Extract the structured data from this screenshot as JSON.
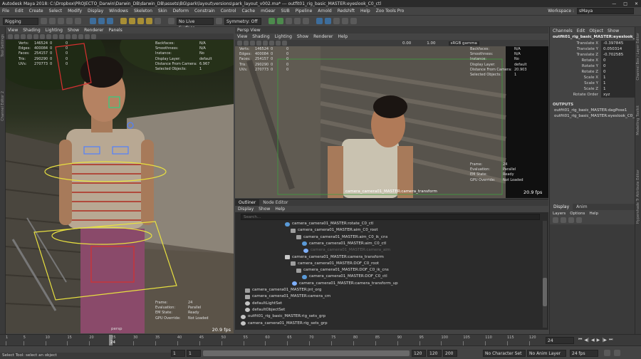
{
  "title_bar": {
    "title": "Autodesk Maya 2018: C:\\Dropbox\\PROJECTO_Darwin\\Darwin_DB\\darwin_DB\\assets\\BG\\park\\layout\\versions\\park_layout_v002.ma*  ---  outfit01_rig_basic_MASTER:eyeslook_C0_ctl",
    "minimize": "—",
    "maximize": "□",
    "close": "✕"
  },
  "menubar": {
    "items": [
      "File",
      "Edit",
      "Create",
      "Select",
      "Modify",
      "Display",
      "Windows",
      "Skeleton",
      "Skin",
      "Deform",
      "Constrain",
      "Control",
      "Cache",
      "mGear",
      "SUB",
      "Pipeline",
      "Arnold",
      "Redshift",
      "Help",
      "Zoo Tools Pro"
    ],
    "workspace_label": "Workspace :",
    "workspace_value": "sMaya"
  },
  "statusline": {
    "menuset": "Rigging",
    "live_surface": "No Live Surface",
    "symmetry": "Symmetry: Off"
  },
  "left_tools_label": "Tool Settings",
  "left_tools_label2": "Channel Editor 2",
  "left_viewport": {
    "menu": [
      "View",
      "Shading",
      "Lighting",
      "Show",
      "Renderer",
      "Panels"
    ],
    "hud_left": [
      {
        "label": "Verts:",
        "a": "146524",
        "b": "0",
        "c": "0"
      },
      {
        "label": "Edges:",
        "a": "400084",
        "b": "0",
        "c": "0"
      },
      {
        "label": "Faces:",
        "a": "254157",
        "b": "0",
        "c": "0"
      },
      {
        "label": "Tris:",
        "a": "290290",
        "b": "0",
        "c": "0"
      },
      {
        "label": "UVs:",
        "a": "270773",
        "b": "0",
        "c": "0"
      }
    ],
    "hud_right": [
      {
        "label": "Backfaces:",
        "value": "N/A"
      },
      {
        "label": "Smoothness:",
        "value": "N/A"
      },
      {
        "label": "Instance:",
        "value": "No"
      },
      {
        "label": "Display Layer:",
        "value": "default"
      },
      {
        "label": "Distance From Camera:",
        "value": "6.967"
      },
      {
        "label": "Selected Objects:",
        "value": "1"
      }
    ],
    "hud_bottom": [
      {
        "label": "Frame:",
        "value": "24"
      },
      {
        "label": "Evaluation:",
        "value": "Parallel"
      },
      {
        "label": "EM State:",
        "value": "Ready"
      },
      {
        "label": "GPU Override:",
        "value": "Not Loaded"
      }
    ],
    "camera_name": "persp",
    "fps": "20.9 fps"
  },
  "persp_view": {
    "title": "Persp View",
    "menu": [
      "View",
      "Shading",
      "Lighting",
      "Show",
      "Renderer",
      "Help"
    ],
    "exposure": "0.00",
    "gamma": "1.00",
    "colorspace": "sRGB gamma",
    "hud_left": [
      {
        "label": "Verts:",
        "a": "146524",
        "b": "0",
        "c": "0"
      },
      {
        "label": "Edges:",
        "a": "400084",
        "b": "0",
        "c": "0"
      },
      {
        "label": "Faces:",
        "a": "254157",
        "b": "0",
        "c": "0"
      },
      {
        "label": "Tris:",
        "a": "290290",
        "b": "0",
        "c": "0"
      },
      {
        "label": "UVs:",
        "a": "270773",
        "b": "0",
        "c": "0"
      }
    ],
    "hud_right": [
      {
        "label": "Backfaces:",
        "value": "N/A"
      },
      {
        "label": "Smoothness:",
        "value": "N/A"
      },
      {
        "label": "Instance:",
        "value": "No"
      },
      {
        "label": "Display Layer:",
        "value": "default"
      },
      {
        "label": "Distance From Camera:",
        "value": "20.903"
      },
      {
        "label": "Selected Objects:",
        "value": "1"
      }
    ],
    "hud_bottom": [
      {
        "label": "Frame:",
        "value": "24"
      },
      {
        "label": "Evaluation:",
        "value": "Parallel"
      },
      {
        "label": "EM State:",
        "value": "Ready"
      },
      {
        "label": "GPU Override:",
        "value": "Not Loaded"
      }
    ],
    "camera_name": "camera_camera01_MASTER:camera_transform",
    "fps": "20.9 fps"
  },
  "outliner": {
    "tabs": [
      "Outliner",
      "Node Editor"
    ],
    "menu": [
      "Display",
      "Show",
      "Help"
    ],
    "search_placeholder": "Search...",
    "items": [
      {
        "label": "camera_camera01_MASTER:rotate_C0_ctl",
        "icon": "crv",
        "dim": false
      },
      {
        "label": "camera_camera01_MASTER:aim_C0_root",
        "icon": "tr",
        "dim": false
      },
      {
        "label": "camera_camera01_MASTER:aim_C0_ik_cns",
        "icon": "tr",
        "dim": false
      },
      {
        "label": "camera_camera01_MASTER:aim_C0_ctl",
        "icon": "crv",
        "dim": false
      },
      {
        "label": "camera_camera01_MASTER:camera_aim",
        "icon": "jnt",
        "dim": true
      },
      {
        "label": "camera_camera01_MASTER:camera_transform",
        "icon": "cam",
        "dim": false
      },
      {
        "label": "camera_camera01_MASTER:DOF_C0_root",
        "icon": "tr",
        "dim": false
      },
      {
        "label": "camera_camera01_MASTER:DOF_C0_ik_cns",
        "icon": "tr",
        "dim": false
      },
      {
        "label": "camera_camera01_MASTER:DOF_C0_ctl",
        "icon": "crv",
        "dim": false
      },
      {
        "label": "camera_camera01_MASTER:camera_transform_up",
        "icon": "jnt",
        "dim": false
      },
      {
        "label": "camera_camera01_MASTER:jnt_org",
        "icon": "tr",
        "dim": false
      },
      {
        "label": "camera_camera01_MASTER:camera_cm",
        "icon": "grp",
        "dim": false
      },
      {
        "label": "defaultLightSet",
        "icon": "set",
        "dim": false
      },
      {
        "label": "defaultObjectSet",
        "icon": "set",
        "dim": false
      },
      {
        "label": "outfit01_rig_basic_MASTER:rig_sets_grp",
        "icon": "set",
        "dim": false
      },
      {
        "label": "camera_camera01_MASTER:rig_sets_grp",
        "icon": "set",
        "dim": false
      }
    ]
  },
  "channel_box": {
    "menu": [
      "Channels",
      "Edit",
      "Object",
      "Show"
    ],
    "object_name": "outfit01_rig_basic_MASTER:eyeslook_C0_ctl",
    "channels": [
      {
        "name": "Translate X",
        "value": "-0.397845"
      },
      {
        "name": "Translate Y",
        "value": "0.050314"
      },
      {
        "name": "Translate Z",
        "value": "-0.702585"
      },
      {
        "name": "Rotate X",
        "value": "0"
      },
      {
        "name": "Rotate Y",
        "value": "0"
      },
      {
        "name": "Rotate Z",
        "value": "0"
      },
      {
        "name": "Scale X",
        "value": "1"
      },
      {
        "name": "Scale Y",
        "value": "1"
      },
      {
        "name": "Scale Z",
        "value": "1"
      },
      {
        "name": "Rotate Order",
        "value": "xyz"
      }
    ],
    "outputs_label": "OUTPUTS",
    "outputs": [
      "outfit01_rig_basic_MASTER:dagPose1",
      "outfit01_rig_basic_MASTER:eyeslook_C0_ctl..."
    ],
    "layer_tabs": [
      "Display",
      "Anim"
    ],
    "layer_menu": [
      "Layers",
      "Options",
      "Help"
    ],
    "side_labels": [
      "Channel Box / Layer Editor",
      "Modelling Toolkit",
      "Attribute Editor",
      "Hypershade Tr"
    ]
  },
  "timeline": {
    "ticks": [
      "1",
      "5",
      "10",
      "15",
      "20",
      "24",
      "25",
      "30",
      "35",
      "40",
      "45",
      "50",
      "55",
      "60",
      "65",
      "70",
      "75",
      "80",
      "85",
      "90",
      "95",
      "100",
      "105",
      "110",
      "115",
      "120"
    ],
    "current_frame": "24",
    "current_frame_box": "24"
  },
  "range_bar": {
    "start": "1",
    "inner_start": "1",
    "inner_end": "120",
    "end": "120",
    "end2": "200",
    "character_set": "No Character Set",
    "anim_layer": "No Anim Layer",
    "fps_setting": "24 fps"
  },
  "help_line": "Select Tool: select an object"
}
